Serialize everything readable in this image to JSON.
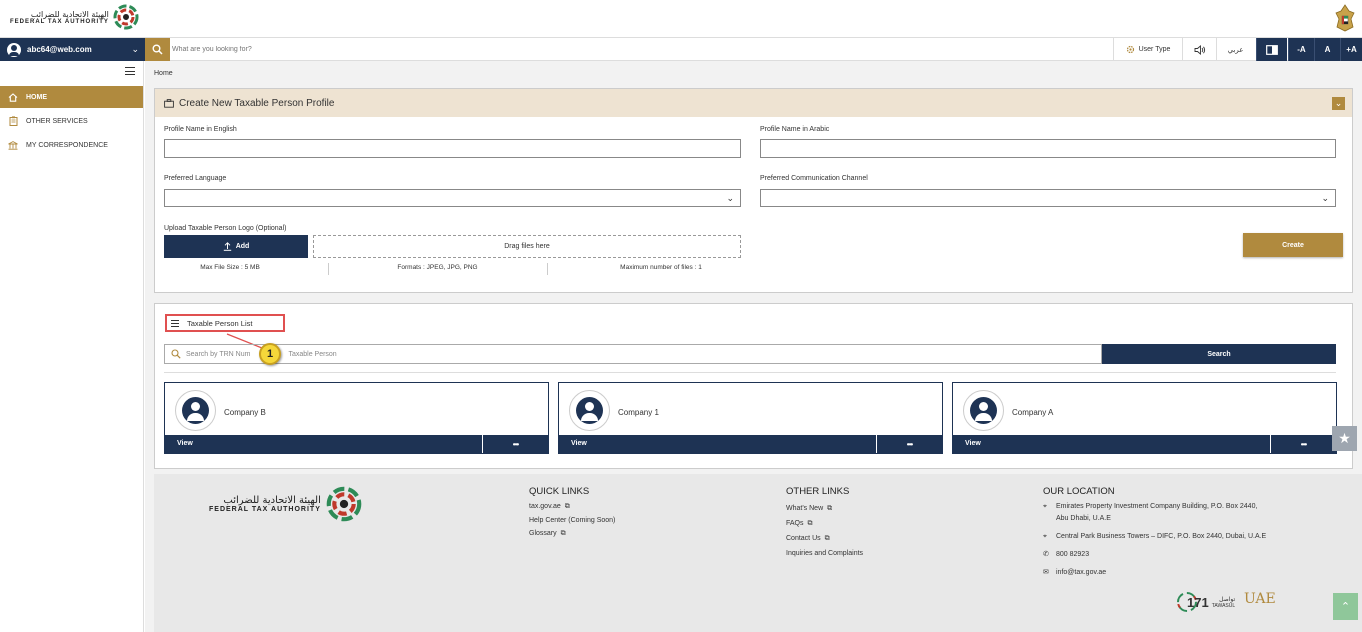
{
  "brand": {
    "name_ar": "الهيئة الاتحادية للضرائب",
    "name_en": "FEDERAL TAX AUTHORITY"
  },
  "header": {
    "user_email": "abc64@web.com",
    "search_placeholder": "What are you looking for?",
    "user_type_label": "User Type",
    "language_label": "عربي",
    "font_decrease": "-A",
    "font_normal": "A",
    "font_increase": "+A"
  },
  "sidebar": {
    "items": [
      {
        "label": "HOME",
        "icon": "home-icon",
        "active": true
      },
      {
        "label": "OTHER SERVICES",
        "icon": "clipboard-icon",
        "active": false
      },
      {
        "label": "MY CORRESPONDENCE",
        "icon": "bank-icon",
        "active": false
      }
    ]
  },
  "breadcrumb": "Home",
  "create_profile": {
    "title": "Create New Taxable Person Profile",
    "collapse_icon": "chevron-down-icon",
    "fields": {
      "name_en_label": "Profile Name in English",
      "name_en_value": "",
      "name_ar_label": "Profile Name in Arabic",
      "name_ar_value": "",
      "language_label": "Preferred Language",
      "language_value": "",
      "channel_label": "Preferred Communication Channel",
      "channel_value": ""
    },
    "upload": {
      "label": "Upload Taxable Person Logo (Optional)",
      "add_label": "Add",
      "drop_label": "Drag files here",
      "max_size": "Max File Size : 5 MB",
      "formats": "Formats : JPEG, JPG, PNG",
      "max_files": "Maximum number of files : 1"
    },
    "create_label": "Create"
  },
  "person_list": {
    "title": "Taxable Person List",
    "callout_number": "1",
    "search_placeholder_left": "Search by TRN Num",
    "search_placeholder_right": "Taxable Person",
    "search_label": "Search",
    "cards": [
      {
        "name": "Company B",
        "view_label": "View",
        "more_label": "•••"
      },
      {
        "name": "Company 1",
        "view_label": "View",
        "more_label": "•••"
      },
      {
        "name": "Company A",
        "view_label": "View",
        "more_label": "•••"
      }
    ]
  },
  "footer": {
    "quick_links": {
      "title": "QUICK LINKS",
      "items": [
        "tax.gov.ae",
        "Help Center (Coming Soon)",
        "Glossary"
      ]
    },
    "other_links": {
      "title": "OTHER LINKS",
      "items": [
        "What's New",
        "FAQs",
        "Contact Us",
        "Inquiries and Complaints"
      ]
    },
    "location": {
      "title": "OUR LOCATION",
      "address1_line1": "Emirates Property Investment Company Building, P.O. Box 2440,",
      "address1_line2": "Abu Dhabi, U.A.E",
      "address2": "Central Park Business Towers – DIFC, P.O. Box 2440, Dubai, U.A.E",
      "phone": "800 82923",
      "email": "info@tax.gov.ae"
    },
    "tawasul_number": "171",
    "tawasul_ar": "تواصل",
    "tawasul_en": "TAWASUL",
    "uae_logo_text": "UAE"
  },
  "colors": {
    "navy": "#1e3354",
    "gold": "#b08a3e",
    "panel_head": "#eee3d2"
  }
}
